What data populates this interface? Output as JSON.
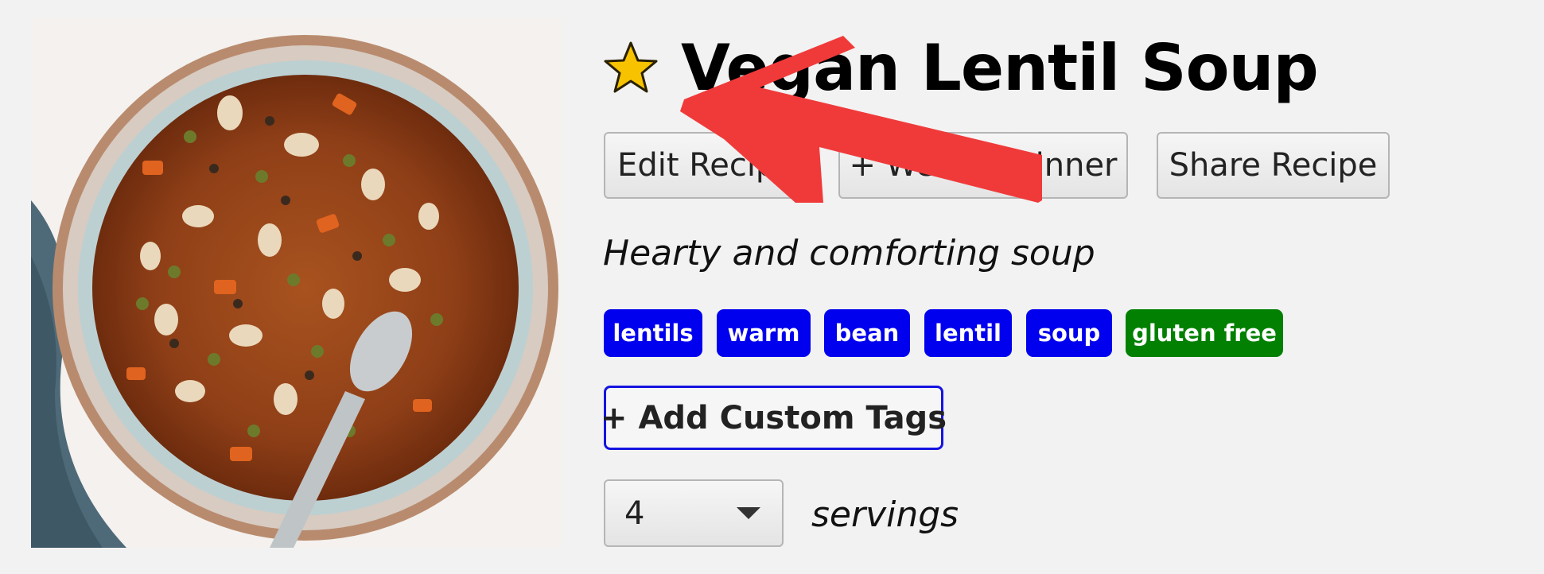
{
  "recipe": {
    "title": "Vegan Lentil Soup",
    "favorite_icon": "star-icon",
    "description": "Hearty and comforting soup",
    "photo": "bowl of vegan lentil soup with a spoon"
  },
  "actions": {
    "edit_label": "Edit Recipe",
    "dinner_label": "+ Weekly Dinner",
    "share_label": "Share Recipe"
  },
  "tags": [
    {
      "label": "lentils",
      "color": "#0000ee"
    },
    {
      "label": "warm",
      "color": "#0000ee"
    },
    {
      "label": "bean",
      "color": "#0000ee"
    },
    {
      "label": "lentil",
      "color": "#0000ee"
    },
    {
      "label": "soup",
      "color": "#0000ee"
    },
    {
      "label": "gluten free",
      "color": "#028002"
    }
  ],
  "add_tags_label": "+ Add Custom Tags",
  "servings": {
    "value": "4",
    "label": "servings"
  },
  "annotation": {
    "arrow_color": "#f03a3a"
  }
}
